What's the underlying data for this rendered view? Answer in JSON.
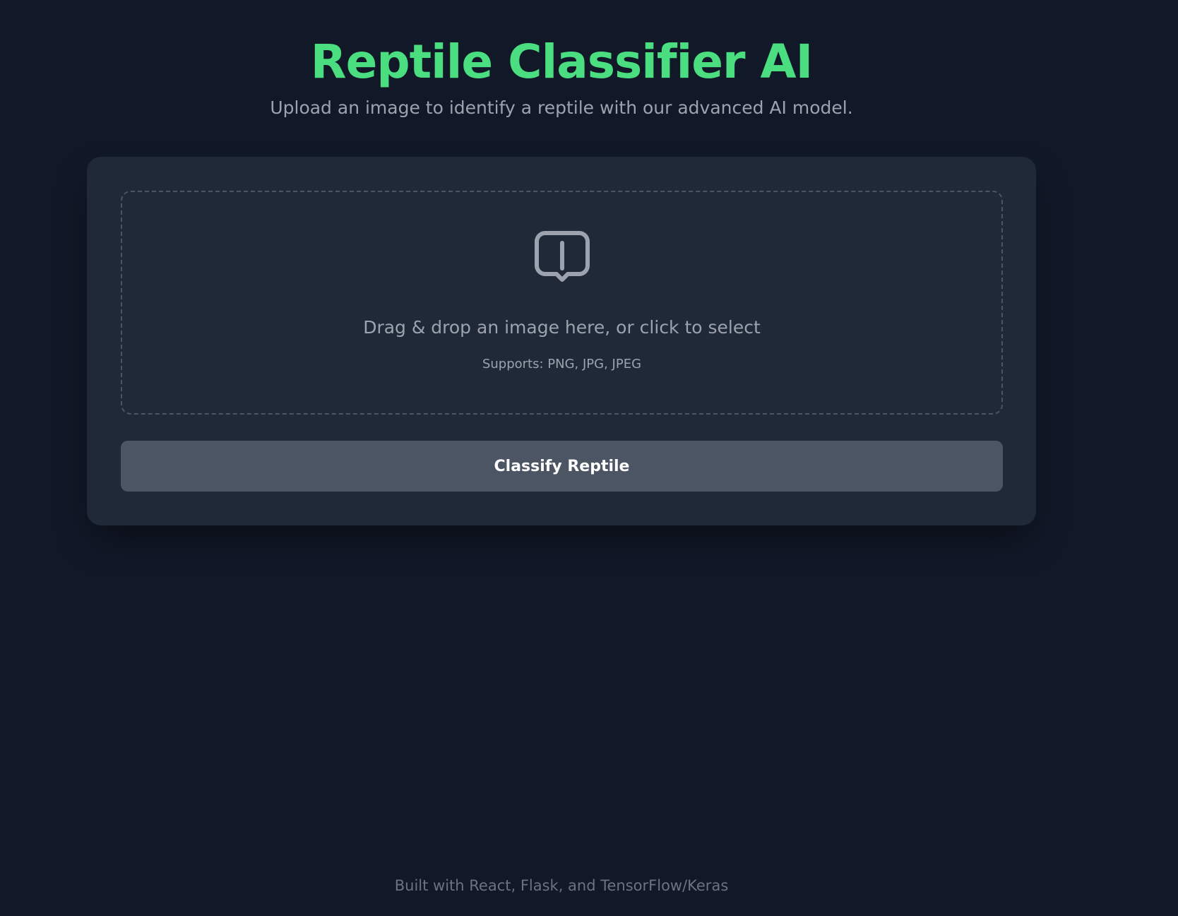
{
  "header": {
    "title": "Reptile Classifier AI",
    "subtitle": "Upload an image to identify a reptile with our advanced AI model."
  },
  "upload": {
    "icon": "upload-icon",
    "prompt": "Drag & drop an image here, or click to select",
    "supports": "Supports: PNG, JPG, JPEG"
  },
  "actions": {
    "classify_label": "Classify Reptile"
  },
  "footer": {
    "text": "Built with React, Flask, and TensorFlow/Keras"
  },
  "colors": {
    "background": "#111827",
    "card": "#1f2937",
    "accent": "#4ade80",
    "muted_text": "#9ca3af",
    "button": "#4b5563"
  }
}
